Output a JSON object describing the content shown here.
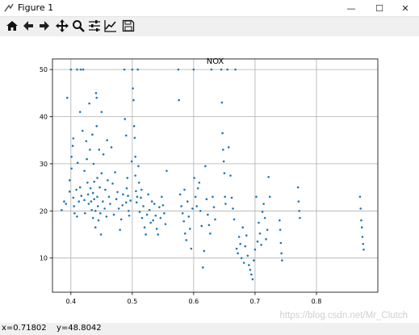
{
  "window": {
    "title": "Figure 1",
    "controls": {
      "minimize": "—",
      "maximize": "☐",
      "close": "✕"
    }
  },
  "toolbar": {
    "buttons": [
      {
        "name": "home-icon"
      },
      {
        "name": "back-icon"
      },
      {
        "name": "forward-icon"
      },
      {
        "name": "pan-icon"
      },
      {
        "name": "zoom-icon"
      },
      {
        "name": "configure-subplots-icon"
      },
      {
        "name": "edit-axis-icon"
      },
      {
        "name": "save-icon"
      }
    ]
  },
  "status": {
    "x_readout": "x=0.71802",
    "y_readout": "y=48.8042"
  },
  "watermark": "https://blog.csdn.net/Mr_Clutch",
  "colors": {
    "points": "#1f77b4",
    "grid": "#b0b0b0",
    "axes": "#000000"
  },
  "chart_data": {
    "type": "scatter",
    "title": "NOX",
    "xlabel": "",
    "ylabel": "",
    "xlim": [
      0.37,
      0.9
    ],
    "ylim": [
      2.75,
      52.25
    ],
    "xticks": [
      "0.4",
      "0.5",
      "0.6",
      "0.7",
      "0.8"
    ],
    "xtick_values": [
      0.4,
      0.5,
      0.6,
      0.7,
      0.8
    ],
    "yticks": [
      "10",
      "20",
      "30",
      "40",
      "50"
    ],
    "ytick_values": [
      10,
      20,
      30,
      40,
      50
    ],
    "grid": true,
    "series": [
      {
        "points": [
          [
            0.385,
            20.2
          ],
          [
            0.389,
            22.0
          ],
          [
            0.392,
            21.5
          ],
          [
            0.394,
            44.0
          ],
          [
            0.398,
            24.1
          ],
          [
            0.398,
            26.5
          ],
          [
            0.4,
            50.0
          ],
          [
            0.401,
            29.0
          ],
          [
            0.401,
            31.5
          ],
          [
            0.403,
            33.8
          ],
          [
            0.404,
            35.4
          ],
          [
            0.404,
            22.8
          ],
          [
            0.405,
            21.0
          ],
          [
            0.406,
            19.5
          ],
          [
            0.409,
            24.5
          ],
          [
            0.41,
            18.8
          ],
          [
            0.41,
            50.0
          ],
          [
            0.411,
            30.2
          ],
          [
            0.413,
            22.0
          ],
          [
            0.415,
            41.0
          ],
          [
            0.415,
            25.0
          ],
          [
            0.416,
            50.0
          ],
          [
            0.417,
            23.2
          ],
          [
            0.419,
            37.0
          ],
          [
            0.42,
            50.0
          ],
          [
            0.422,
            28.5
          ],
          [
            0.422,
            22.3
          ],
          [
            0.423,
            19.5
          ],
          [
            0.425,
            34.8
          ],
          [
            0.426,
            31.0
          ],
          [
            0.427,
            26.0
          ],
          [
            0.428,
            23.5
          ],
          [
            0.429,
            21.5
          ],
          [
            0.43,
            42.8
          ],
          [
            0.431,
            33.0
          ],
          [
            0.432,
            24.8
          ],
          [
            0.433,
            22.0
          ],
          [
            0.434,
            20.2
          ],
          [
            0.435,
            36.2
          ],
          [
            0.436,
            18.5
          ],
          [
            0.436,
            23.8
          ],
          [
            0.437,
            30.0
          ],
          [
            0.438,
            22.5
          ],
          [
            0.438,
            26.2
          ],
          [
            0.44,
            20.0
          ],
          [
            0.44,
            16.5
          ],
          [
            0.441,
            45.0
          ],
          [
            0.442,
            44.0
          ],
          [
            0.442,
            38.0
          ],
          [
            0.443,
            27.0
          ],
          [
            0.443,
            23.0
          ],
          [
            0.444,
            21.0
          ],
          [
            0.445,
            18.0
          ],
          [
            0.446,
            33.0
          ],
          [
            0.447,
            25.0
          ],
          [
            0.448,
            19.5
          ],
          [
            0.449,
            15.0
          ],
          [
            0.45,
            41.0
          ],
          [
            0.45,
            28.0
          ],
          [
            0.452,
            22.0
          ],
          [
            0.453,
            32.0
          ],
          [
            0.455,
            20.5
          ],
          [
            0.456,
            24.5
          ],
          [
            0.458,
            18.8
          ],
          [
            0.459,
            35.0
          ],
          [
            0.46,
            26.5
          ],
          [
            0.462,
            23.0
          ],
          [
            0.464,
            21.5
          ],
          [
            0.466,
            33.5
          ],
          [
            0.468,
            25.8
          ],
          [
            0.47,
            19.2
          ],
          [
            0.472,
            28.2
          ],
          [
            0.474,
            22.5
          ],
          [
            0.476,
            24.0
          ],
          [
            0.478,
            20.5
          ],
          [
            0.48,
            16.0
          ],
          [
            0.482,
            18.2
          ],
          [
            0.484,
            21.2
          ],
          [
            0.485,
            23.5
          ],
          [
            0.487,
            50.0
          ],
          [
            0.488,
            39.5
          ],
          [
            0.49,
            36.0
          ],
          [
            0.49,
            21.8
          ],
          [
            0.491,
            24.8
          ],
          [
            0.492,
            27.0
          ],
          [
            0.493,
            23.2
          ],
          [
            0.494,
            20.0
          ],
          [
            0.495,
            19.0
          ],
          [
            0.497,
            22.2
          ],
          [
            0.499,
            30.5
          ],
          [
            0.5,
            50.0
          ],
          [
            0.501,
            46.0
          ],
          [
            0.502,
            43.5
          ],
          [
            0.503,
            38.0
          ],
          [
            0.504,
            35.5
          ],
          [
            0.505,
            31.5
          ],
          [
            0.505,
            27.5
          ],
          [
            0.506,
            24.2
          ],
          [
            0.507,
            21.8
          ],
          [
            0.508,
            23.0
          ],
          [
            0.509,
            50.0
          ],
          [
            0.51,
            29.5
          ],
          [
            0.511,
            26.0
          ],
          [
            0.512,
            19.8
          ],
          [
            0.514,
            22.8
          ],
          [
            0.515,
            24.5
          ],
          [
            0.516,
            18.5
          ],
          [
            0.518,
            21.0
          ],
          [
            0.52,
            16.5
          ],
          [
            0.522,
            15.0
          ],
          [
            0.524,
            19.2
          ],
          [
            0.526,
            23.5
          ],
          [
            0.528,
            20.2
          ],
          [
            0.53,
            17.5
          ],
          [
            0.532,
            22.0
          ],
          [
            0.534,
            18.0
          ],
          [
            0.536,
            21.5
          ],
          [
            0.538,
            19.0
          ],
          [
            0.54,
            16.2
          ],
          [
            0.542,
            15.0
          ],
          [
            0.544,
            20.8
          ],
          [
            0.546,
            18.5
          ],
          [
            0.548,
            23.0
          ],
          [
            0.55,
            21.2
          ],
          [
            0.552,
            19.5
          ],
          [
            0.554,
            17.2
          ],
          [
            0.556,
            28.5
          ],
          [
            0.575,
            50.0
          ],
          [
            0.576,
            43.5
          ],
          [
            0.578,
            23.5
          ],
          [
            0.58,
            21.0
          ],
          [
            0.582,
            19.5
          ],
          [
            0.584,
            17.8
          ],
          [
            0.585,
            24.5
          ],
          [
            0.586,
            15.2
          ],
          [
            0.588,
            13.8
          ],
          [
            0.59,
            22.0
          ],
          [
            0.592,
            18.8
          ],
          [
            0.594,
            16.2
          ],
          [
            0.596,
            12.0
          ],
          [
            0.598,
            20.5
          ],
          [
            0.6,
            50.0
          ],
          [
            0.601,
            27.0
          ],
          [
            0.603,
            23.0
          ],
          [
            0.605,
            21.0
          ],
          [
            0.607,
            24.8
          ],
          [
            0.609,
            26.0
          ],
          [
            0.611,
            20.0
          ],
          [
            0.613,
            16.8
          ],
          [
            0.615,
            8.0
          ],
          [
            0.617,
            11.5
          ],
          [
            0.619,
            29.5
          ],
          [
            0.621,
            22.5
          ],
          [
            0.623,
            19.2
          ],
          [
            0.625,
            17.0
          ],
          [
            0.627,
            15.2
          ],
          [
            0.629,
            50.0
          ],
          [
            0.631,
            23.0
          ],
          [
            0.633,
            20.8
          ],
          [
            0.635,
            18.2
          ],
          [
            0.645,
            50.0
          ],
          [
            0.646,
            43.0
          ],
          [
            0.647,
            36.5
          ],
          [
            0.648,
            33.0
          ],
          [
            0.649,
            30.5
          ],
          [
            0.65,
            28.0
          ],
          [
            0.651,
            23.0
          ],
          [
            0.652,
            21.5
          ],
          [
            0.655,
            50.0
          ],
          [
            0.657,
            33.5
          ],
          [
            0.66,
            27.5
          ],
          [
            0.662,
            22.8
          ],
          [
            0.664,
            20.5
          ],
          [
            0.666,
            18.2
          ],
          [
            0.668,
            50.0
          ],
          [
            0.67,
            12.0
          ],
          [
            0.672,
            11.0
          ],
          [
            0.674,
            14.5
          ],
          [
            0.676,
            13.0
          ],
          [
            0.678,
            10.0
          ],
          [
            0.68,
            16.5
          ],
          [
            0.682,
            9.0
          ],
          [
            0.684,
            12.5
          ],
          [
            0.686,
            14.8
          ],
          [
            0.688,
            10.5
          ],
          [
            0.69,
            8.5
          ],
          [
            0.692,
            7.5
          ],
          [
            0.694,
            6.5
          ],
          [
            0.696,
            5.5
          ],
          [
            0.698,
            9.5
          ],
          [
            0.7,
            11.8
          ],
          [
            0.702,
            23.0
          ],
          [
            0.704,
            13.5
          ],
          [
            0.706,
            17.5
          ],
          [
            0.708,
            15.2
          ],
          [
            0.71,
            12.8
          ],
          [
            0.712,
            19.8
          ],
          [
            0.714,
            21.5
          ],
          [
            0.716,
            18.5
          ],
          [
            0.718,
            14.0
          ],
          [
            0.72,
            16.0
          ],
          [
            0.722,
            27.2
          ],
          [
            0.724,
            23.0
          ],
          [
            0.74,
            18.0
          ],
          [
            0.741,
            16.0
          ],
          [
            0.742,
            13.2
          ],
          [
            0.743,
            11.0
          ],
          [
            0.744,
            9.5
          ],
          [
            0.77,
            25.0
          ],
          [
            0.771,
            22.0
          ],
          [
            0.772,
            20.0
          ],
          [
            0.773,
            18.5
          ],
          [
            0.871,
            23.0
          ],
          [
            0.872,
            20.5
          ],
          [
            0.873,
            18.0
          ],
          [
            0.874,
            16.5
          ],
          [
            0.875,
            14.5
          ],
          [
            0.876,
            13.0
          ],
          [
            0.877,
            11.8
          ]
        ]
      }
    ]
  }
}
